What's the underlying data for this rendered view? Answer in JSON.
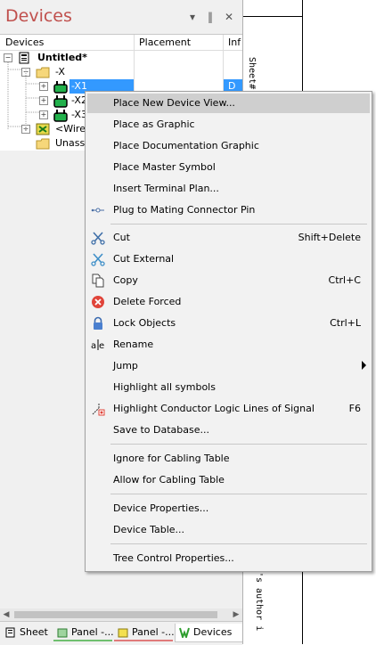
{
  "panel": {
    "title": "Devices",
    "title_color": "#c0504d",
    "buttons": {
      "dropdown": "▾",
      "pin": "‖",
      "close": "✕"
    }
  },
  "tree": {
    "columns": [
      "Devices",
      "Placement",
      "Inf"
    ],
    "rows": [
      {
        "label": "Untitled*",
        "icon": "document-icon",
        "expander": "−"
      },
      {
        "label": "-X",
        "icon": "folder-icon",
        "expander": "−"
      },
      {
        "label": "-X1",
        "icon": "connector-icon",
        "expander": "+",
        "selected": true,
        "info": "D"
      },
      {
        "label": "-X2",
        "icon": "connector-icon",
        "expander": "+"
      },
      {
        "label": "-X3",
        "icon": "connector-icon",
        "expander": "+"
      },
      {
        "label": "<Wires",
        "icon": "wires-icon",
        "expander": "+"
      },
      {
        "label": "Unassi",
        "icon": "folder-icon",
        "expander": ""
      }
    ]
  },
  "tabs": [
    {
      "label": "Sheet",
      "icon": "sheet-icon"
    },
    {
      "label": "Panel -...",
      "icon": "panel-icon"
    },
    {
      "label": "Panel -...",
      "icon": "panel-yellow-icon"
    },
    {
      "label": "Devices",
      "icon": "devices-icon",
      "active": true
    }
  ],
  "canvas": {
    "text_top": "Sheet#",
    "text_bottom": "'s author i"
  },
  "menu": {
    "items": [
      {
        "label": "Place New Device View...",
        "hover": true
      },
      {
        "label": "Place as Graphic"
      },
      {
        "label": "Place Documentation Graphic"
      },
      {
        "label": "Place Master Symbol"
      },
      {
        "label": "Insert Terminal Plan..."
      },
      {
        "label": "Plug to Mating Connector Pin",
        "icon": "plug-icon"
      },
      {
        "label": "Cut",
        "icon": "scissors-icon",
        "shortcut": "Shift+Delete"
      },
      {
        "label": "Cut External",
        "icon": "scissors-external-icon"
      },
      {
        "label": "Copy",
        "icon": "copy-icon",
        "shortcut": "Ctrl+C"
      },
      {
        "label": "Delete Forced",
        "icon": "delete-icon"
      },
      {
        "label": "Lock Objects",
        "icon": "lock-icon",
        "shortcut": "Ctrl+L"
      },
      {
        "label": "Rename",
        "icon": "rename-icon"
      },
      {
        "label": "Jump",
        "submenu": true
      },
      {
        "label": "Highlight all symbols"
      },
      {
        "label": "Highlight Conductor Logic Lines of Signal",
        "icon": "highlight-icon",
        "shortcut": "F6"
      },
      {
        "label": "Save to Database..."
      },
      {
        "label": "Ignore for Cabling Table"
      },
      {
        "label": "Allow for Cabling Table"
      },
      {
        "label": "Device Properties..."
      },
      {
        "label": "Device Table..."
      },
      {
        "label": "Tree Control Properties..."
      }
    ]
  }
}
